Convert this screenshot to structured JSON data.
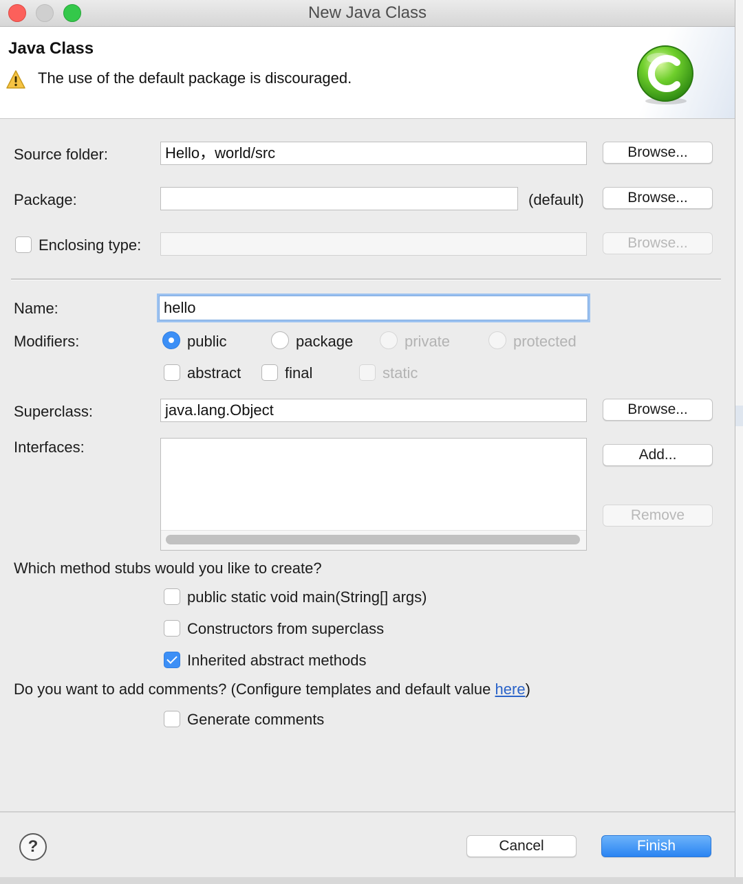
{
  "window": {
    "title": "New Java Class",
    "controls": [
      "close",
      "minimize",
      "zoom"
    ]
  },
  "header": {
    "title": "Java Class",
    "message": "The use of the default package is discouraged.",
    "message_icon": "warning-icon",
    "wizard_icon": "java-class-icon"
  },
  "form": {
    "source_folder": {
      "label": "Source folder:",
      "value": "Hello，world/src",
      "button": "Browse..."
    },
    "package": {
      "label": "Package:",
      "value": "",
      "hint": "(default)",
      "button": "Browse..."
    },
    "enclosing_type": {
      "label": "Enclosing type:",
      "checked": false,
      "value": "",
      "button": "Browse..."
    },
    "name": {
      "label": "Name:",
      "value": "hello"
    },
    "modifiers": {
      "label": "Modifiers:",
      "access": [
        {
          "label": "public",
          "selected": true,
          "enabled": true
        },
        {
          "label": "package",
          "selected": false,
          "enabled": true
        },
        {
          "label": "private",
          "selected": false,
          "enabled": false
        },
        {
          "label": "protected",
          "selected": false,
          "enabled": false
        }
      ],
      "flags": [
        {
          "label": "abstract",
          "checked": false,
          "enabled": true
        },
        {
          "label": "final",
          "checked": false,
          "enabled": true
        },
        {
          "label": "static",
          "checked": false,
          "enabled": false
        }
      ]
    },
    "superclass": {
      "label": "Superclass:",
      "value": "java.lang.Object",
      "button": "Browse..."
    },
    "interfaces": {
      "label": "Interfaces:",
      "items": [],
      "add_button": "Add...",
      "remove_button": "Remove"
    }
  },
  "stubs": {
    "question": "Which method stubs would you like to create?",
    "options": [
      {
        "label": "public static void main(String[] args)",
        "checked": false
      },
      {
        "label": "Constructors from superclass",
        "checked": false
      },
      {
        "label": "Inherited abstract methods",
        "checked": true
      }
    ]
  },
  "comments": {
    "question_prefix": "Do you want to add comments? (Configure templates and default value ",
    "link": "here",
    "question_suffix": ")",
    "option": {
      "label": "Generate comments",
      "checked": false
    }
  },
  "footer": {
    "help_icon": "help-icon",
    "help_glyph": "?",
    "cancel": "Cancel",
    "finish": "Finish"
  },
  "colors": {
    "accent": "#3c8ff6",
    "close": "#fc605b",
    "zoom": "#34c84a",
    "link": "#2a63c9"
  }
}
